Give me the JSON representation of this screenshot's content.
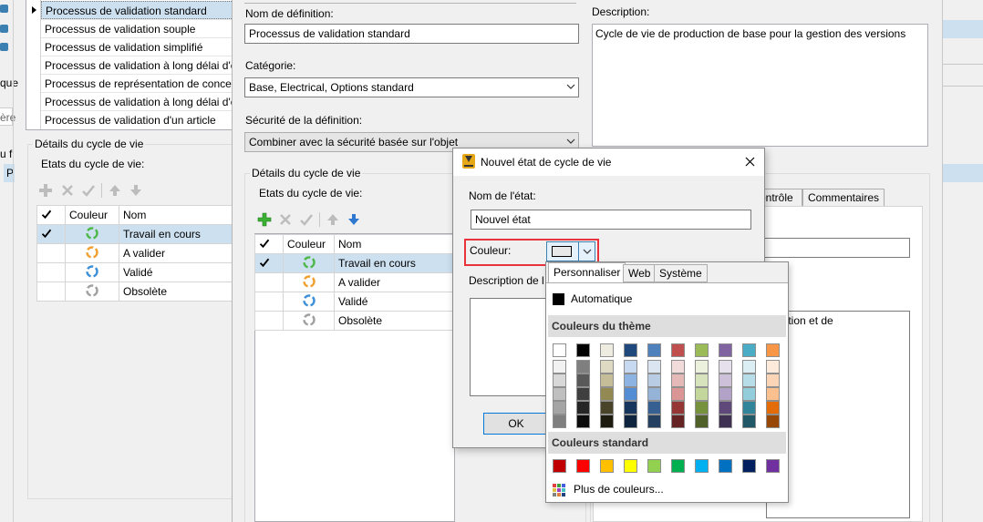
{
  "left_list": {
    "items": [
      "Processus de validation standard",
      "Processus de validation souple",
      "Processus de validation simplifié",
      "Processus de validation à long délai d'e",
      "Processus de représentation de concep",
      "Processus de validation à long délai d'e",
      "Processus de validation d'un article"
    ]
  },
  "left_panel": {
    "partial_label_1": "que",
    "partial_label_2": "ère",
    "partial_label_3": "u f",
    "partial_label_4": "P",
    "group_title": "Détails du cycle de vie",
    "states_label": "Etats du cycle de vie:",
    "col_color": "Couleur",
    "col_name": "Nom",
    "states": [
      "Travail en cours",
      "A valider",
      "Validé",
      "Obsolète"
    ]
  },
  "center": {
    "def_name_label": "Nom de définition:",
    "def_name_value": "Processus de validation standard",
    "category_label": "Catégorie:",
    "category_value": "Base, Electrical, Options standard",
    "security_label": "Sécurité de la définition:",
    "security_value": "Combiner avec la sécurité basée sur l'objet",
    "group_title": "Détails du cycle de vie",
    "states_label": "Etats du cycle de vie:",
    "col_color": "Couleur",
    "col_name": "Nom",
    "states": [
      "Travail en cours",
      "A valider",
      "Validé",
      "Obsolète"
    ]
  },
  "right": {
    "description_label": "Description:",
    "description_value": "Cycle de vie de production de base pour la gestion des versions",
    "tab_control_partial": "ontrôle",
    "tab_comments": "Commentaires",
    "partial_text": "ception et de"
  },
  "dialog": {
    "title": "Nouvel état de cycle de vie",
    "state_name_label": "Nom de l'état:",
    "state_name_value": "Nouvel état",
    "color_label": "Couleur:",
    "description_label": "Description de l",
    "ok_label": "OK"
  },
  "palette": {
    "tabs": [
      "Personnaliser",
      "Web",
      "Système"
    ],
    "automatic_label": "Automatique",
    "theme_header": "Couleurs du thème",
    "standard_header": "Couleurs standard",
    "more_colors_label": "Plus de couleurs...",
    "theme_top": [
      "#ffffff",
      "#000000",
      "#eeece1",
      "#1f497d",
      "#4f81bd",
      "#c0504d",
      "#9bbb59",
      "#8064a2",
      "#4bacc6",
      "#f79646"
    ],
    "theme_shades": [
      [
        "#f2f2f2",
        "#7f7f7f",
        "#ddd9c3",
        "#c6d9f0",
        "#dbe5f1",
        "#f2dcdb",
        "#ebf1dd",
        "#e5e0ec",
        "#dbeef3",
        "#fdeada"
      ],
      [
        "#d8d8d8",
        "#595959",
        "#c4bd97",
        "#8db3e2",
        "#b8cce4",
        "#e5b9b7",
        "#d7e3bc",
        "#ccc1d9",
        "#b7dde8",
        "#fbd5b5"
      ],
      [
        "#bfbfbf",
        "#3f3f3f",
        "#938953",
        "#548dd4",
        "#95b3d7",
        "#d99694",
        "#c3d69b",
        "#b2a2c7",
        "#92cddc",
        "#fac08f"
      ],
      [
        "#a5a5a5",
        "#262626",
        "#494429",
        "#17365d",
        "#366092",
        "#953734",
        "#76923c",
        "#5f497a",
        "#31859b",
        "#e36c09"
      ],
      [
        "#7f7f7f",
        "#0c0c0c",
        "#1d1b10",
        "#0f243e",
        "#244061",
        "#632423",
        "#4f6128",
        "#3f3151",
        "#205867",
        "#974806"
      ]
    ],
    "standard": [
      "#c00000",
      "#ff0000",
      "#ffc000",
      "#ffff00",
      "#92d050",
      "#00b050",
      "#00b0f0",
      "#0070c0",
      "#002060",
      "#7030a0"
    ]
  },
  "colors": {
    "selection": "#cde0f0",
    "highlight_red": "#e8323c",
    "accent_blue": "#3c7fb1"
  },
  "icons": {
    "state_icon": "recycle-arrows-icon",
    "add": "plus-icon",
    "delete": "x-icon",
    "check": "check-icon",
    "up": "arrow-up-icon",
    "down": "arrow-down-icon"
  }
}
